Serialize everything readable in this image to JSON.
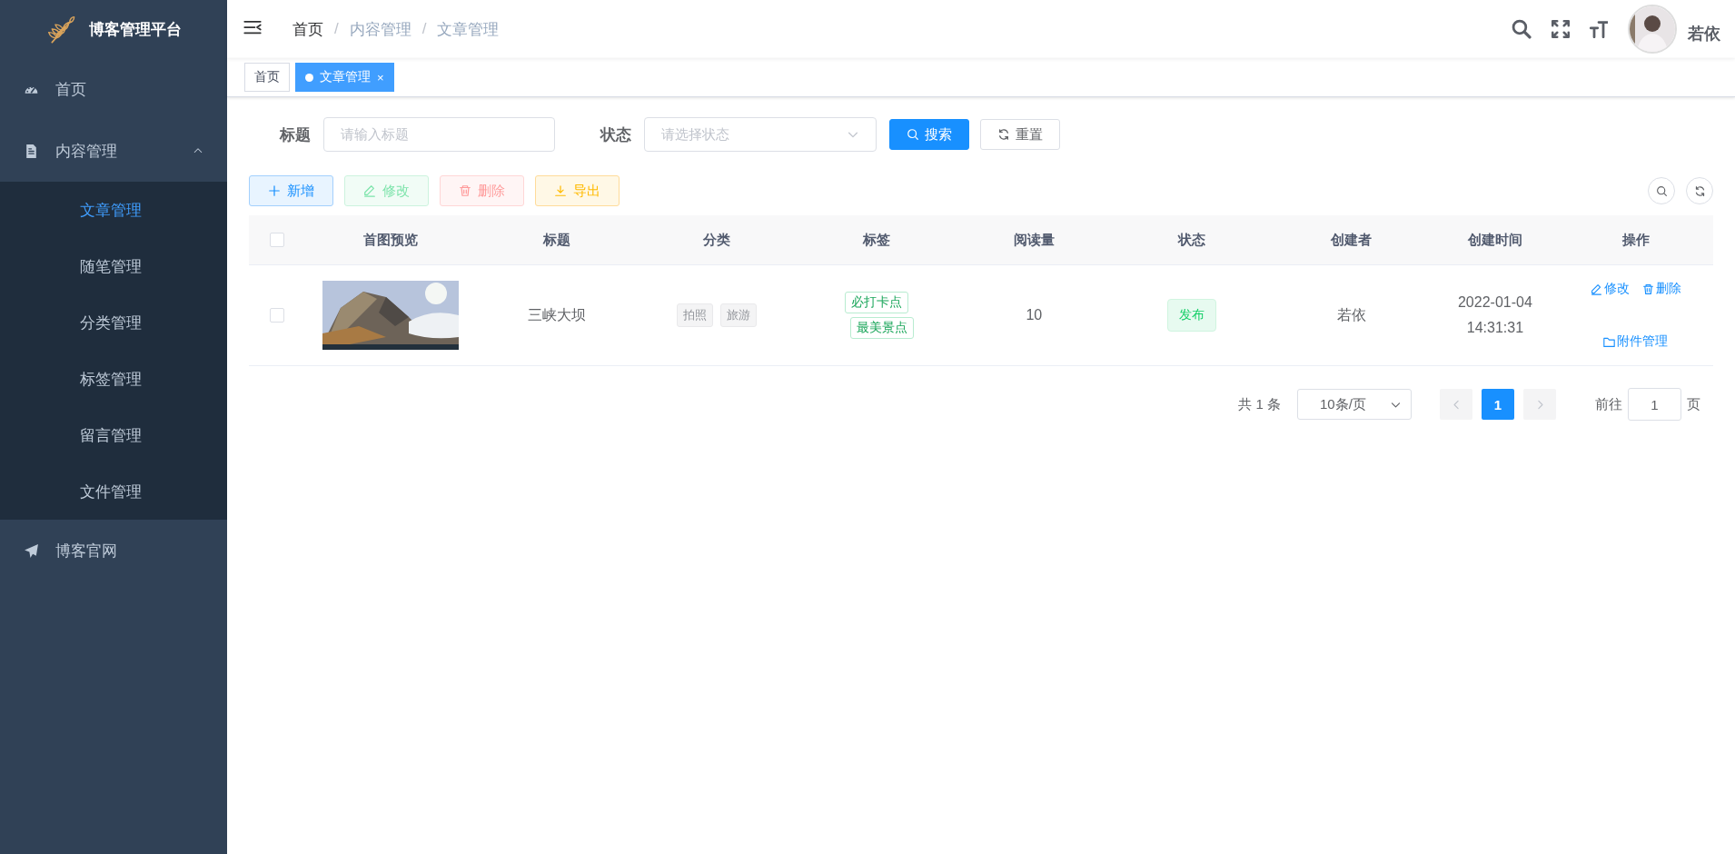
{
  "sidebar": {
    "logo_title": "博客管理平台",
    "items": [
      {
        "label": "首页",
        "kind": "gauge"
      },
      {
        "label": "内容管理",
        "kind": "document",
        "expanded": true,
        "children": [
          {
            "label": "文章管理",
            "selected": true
          },
          {
            "label": "随笔管理",
            "selected": false
          },
          {
            "label": "分类管理",
            "selected": false
          },
          {
            "label": "标签管理",
            "selected": false
          },
          {
            "label": "留言管理",
            "selected": false
          },
          {
            "label": "文件管理",
            "selected": false
          }
        ]
      },
      {
        "label": "博客官网",
        "kind": "plane"
      }
    ]
  },
  "header": {
    "breadcrumb": [
      "首页",
      "内容管理",
      "文章管理"
    ],
    "separator": "/",
    "username": "若依"
  },
  "tags": [
    {
      "label": "首页",
      "selected": false
    },
    {
      "label": "文章管理",
      "selected": true,
      "close": "×"
    }
  ],
  "search_form": {
    "fields": [
      {
        "label": "标题",
        "placeholder": "请输入标题",
        "kind": "input"
      },
      {
        "label": "状态",
        "placeholder": "请选择状态",
        "kind": "select"
      }
    ],
    "buttons": [
      {
        "label": "搜索",
        "kind": "primary"
      },
      {
        "label": "重置",
        "kind": "default"
      }
    ]
  },
  "toolbar": [
    {
      "label": "新增",
      "kind": "primary",
      "disabled": false
    },
    {
      "label": "修改",
      "kind": "success",
      "disabled": true
    },
    {
      "label": "删除",
      "kind": "danger",
      "disabled": true
    },
    {
      "label": "导出",
      "kind": "warning",
      "disabled": false
    }
  ],
  "table": {
    "header_checked": false,
    "columns": [
      "首图预览",
      "标题",
      "分类",
      "标签",
      "阅读量",
      "状态",
      "创建者",
      "创建时间",
      "操作"
    ],
    "rows": [
      {
        "checked": false,
        "cover": {
          "kind": "picture"
        },
        "title": "三峡大坝",
        "categories": [
          "拍照",
          "旅游"
        ],
        "tags": [
          "必打卡点",
          "最美景点"
        ],
        "views": "10",
        "status": "发布",
        "creator": "若依",
        "created": "2022-01-04 14:31:31",
        "actions": [
          {
            "label": "修改",
            "kind": "edit"
          },
          {
            "label": "删除",
            "kind": "delete"
          },
          {
            "label": "附件管理",
            "kind": "attachment"
          }
        ]
      }
    ]
  },
  "pagination": {
    "total": "共 1 条",
    "page_size": "10条/页",
    "pages": [
      {
        "label": "1",
        "selected": true
      }
    ],
    "goto_label": "前往",
    "goto_value": "1",
    "page_unit": "页"
  }
}
